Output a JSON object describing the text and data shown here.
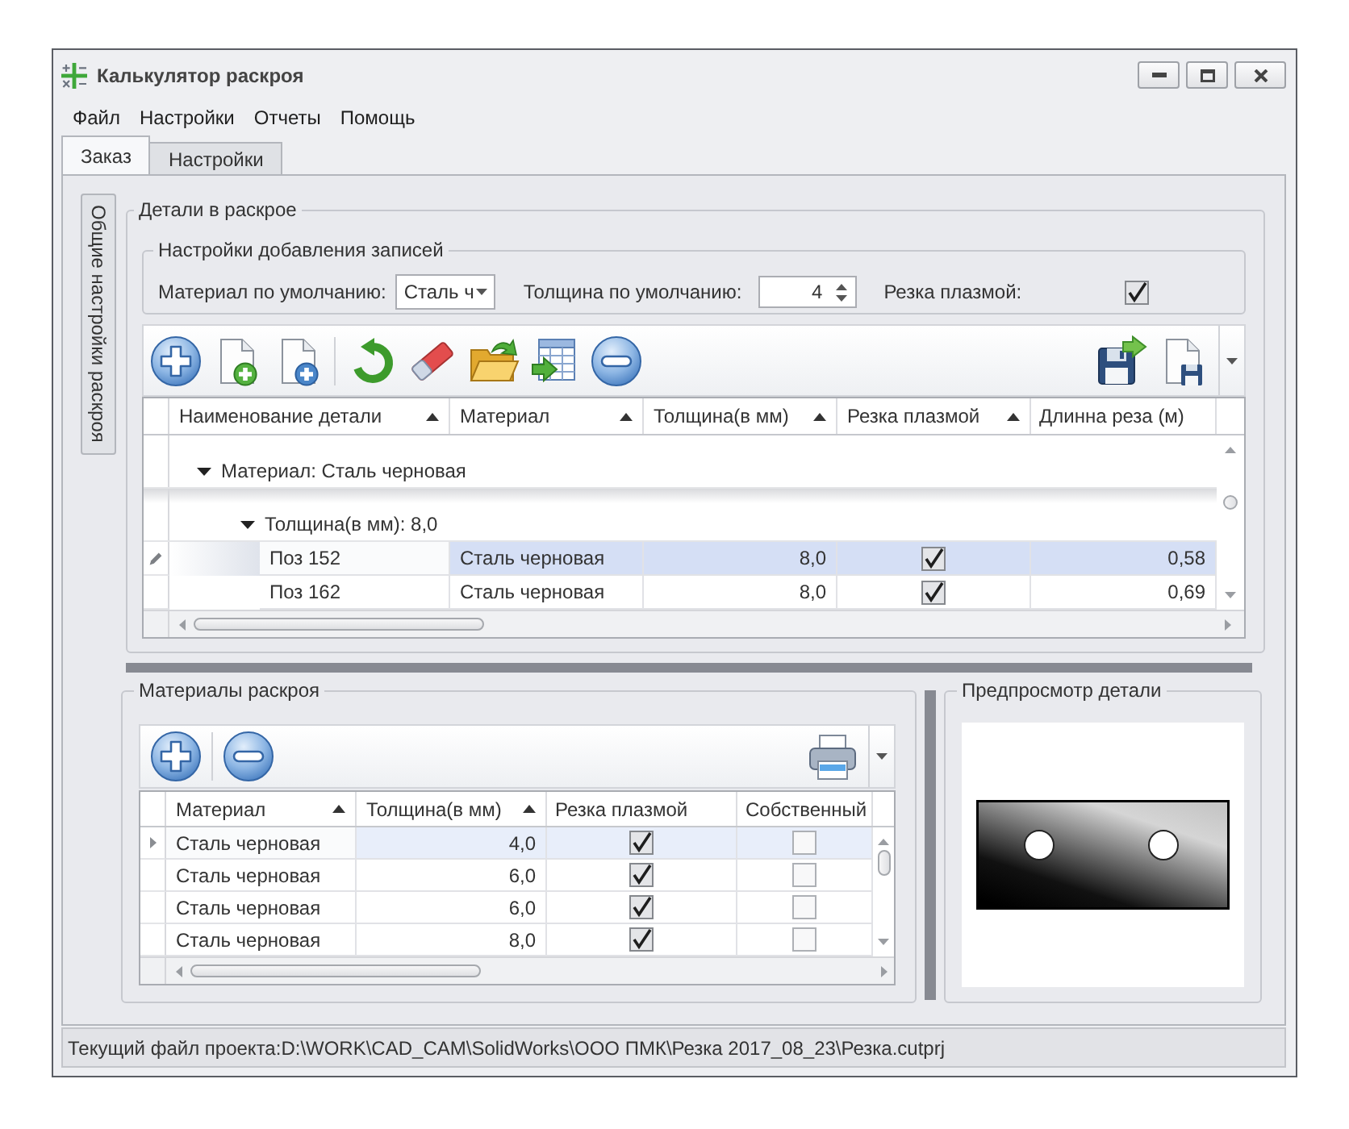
{
  "window": {
    "title": "Калькулятор раскроя"
  },
  "menu": [
    {
      "label": "Файл"
    },
    {
      "label": "Настройки"
    },
    {
      "label": "Отчеты"
    },
    {
      "label": "Помощь"
    }
  ],
  "tabs": [
    {
      "label": "Заказ",
      "selected": true
    },
    {
      "label": "Настройки",
      "selected": false
    }
  ],
  "side_tab": {
    "label": "Общие настройки раскроя"
  },
  "parts": {
    "title": "Детали в раскрое",
    "defaults": {
      "title": "Настройки добавления записей",
      "fields": [
        {
          "kind": "combo",
          "label": "Материал по умолчанию:",
          "value": "Сталь ч"
        },
        {
          "kind": "spin",
          "label": "Толщина по умолчанию:",
          "value": "4"
        },
        {
          "kind": "check",
          "label": "Резка плазмой:",
          "checked": true
        }
      ]
    },
    "table": {
      "focused": true,
      "columns": [
        {
          "label": "Наименование детали",
          "kind": "text",
          "sorted": true
        },
        {
          "label": "Материал",
          "kind": "text",
          "sorted": true
        },
        {
          "label": "Толщина(в мм)",
          "kind": "number",
          "sorted": true
        },
        {
          "label": "Резка плазмой",
          "kind": "check",
          "sorted": true
        },
        {
          "label": "Длинна реза (м)",
          "kind": "number",
          "sorted": false
        }
      ],
      "groups": [
        {
          "label": "Материал: Сталь черновая",
          "expanded": true,
          "children": [
            {
              "label": "Толщина(в мм): 8,0",
              "expanded": true,
              "rows": [
                {
                  "cells": [
                    "Поз 152",
                    "Сталь черновая",
                    "8,0",
                    true,
                    "0,58"
                  ],
                  "selected": true
                },
                {
                  "cells": [
                    "Поз 162",
                    "Сталь черновая",
                    "8,0",
                    true,
                    "0,69"
                  ],
                  "selected": false
                }
              ]
            }
          ]
        }
      ]
    }
  },
  "materials": {
    "title": "Материалы раскроя",
    "table": {
      "focused": false,
      "columns": [
        {
          "label": "Материал",
          "kind": "text",
          "sorted": true
        },
        {
          "label": "Толщина(в мм)",
          "kind": "number",
          "sorted": true
        },
        {
          "label": "Резка плазмой",
          "kind": "check",
          "sorted": false
        },
        {
          "label": "Собственный",
          "kind": "check",
          "sorted": false
        }
      ],
      "rows": [
        {
          "cells": [
            "Сталь черновая",
            "4,0",
            true,
            false
          ],
          "selected": true
        },
        {
          "cells": [
            "Сталь черновая",
            "6,0",
            true,
            false
          ],
          "selected": false
        },
        {
          "cells": [
            "Сталь черновая",
            "6,0",
            true,
            false
          ],
          "selected": false
        },
        {
          "cells": [
            "Сталь черновая",
            "8,0",
            true,
            false
          ],
          "selected": false
        }
      ]
    }
  },
  "preview": {
    "title": "Предпросмотр детали"
  },
  "status_bar": {
    "text": "Текущий файл проекта:D:\\WORK\\CAD_CAM\\SolidWorks\\ООО ПМК\\Резка 2017_08_23\\Резка.cutprj"
  }
}
